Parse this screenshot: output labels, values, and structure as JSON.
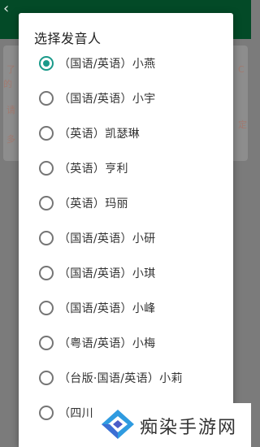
{
  "background": {
    "app_bar_color": "#034a27",
    "back_icon": "arrow-left-icon",
    "edge_fragments": [
      "了",
      "的",
      "请",
      "多",
      "C",
      "定"
    ]
  },
  "dialog": {
    "title": "选择发音人",
    "accent_color": "#1a9a8a",
    "options": [
      {
        "label": "（国语/英语）小燕",
        "checked": true
      },
      {
        "label": "（国语/英语）小宇",
        "checked": false
      },
      {
        "label": "（英语）凯瑟琳",
        "checked": false
      },
      {
        "label": "（英语）亨利",
        "checked": false
      },
      {
        "label": "（英语）玛丽",
        "checked": false
      },
      {
        "label": "（国语/英语）小研",
        "checked": false
      },
      {
        "label": "（国语/英语）小琪",
        "checked": false
      },
      {
        "label": "（国语/英语）小峰",
        "checked": false
      },
      {
        "label": "（粤语/英语）小梅",
        "checked": false
      },
      {
        "label": "（台版·国语/英语）小莉",
        "checked": false
      },
      {
        "label": "（四川",
        "checked": false
      }
    ]
  },
  "watermark": {
    "text": "痴染手游网",
    "logo_icon": "diamond-logo-icon"
  }
}
